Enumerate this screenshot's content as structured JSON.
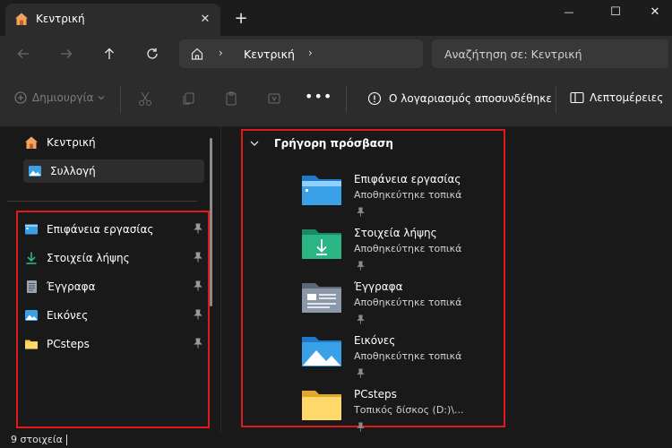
{
  "window": {
    "tab_title": "Κεντρική",
    "tab_close": "✕",
    "new_tab": "+",
    "minimize": "—",
    "maximize": "☐",
    "close": "✕"
  },
  "navbar": {
    "breadcrumb": "Κεντρική",
    "breadcrumb_sep": "›",
    "search_placeholder": "Αναζήτηση σε: Κεντρική"
  },
  "toolbar": {
    "new_label": "Δημιουργία",
    "more": "•••",
    "disconnected_label": "Ο λογαριασμός αποσυνδέθηκε",
    "details_label": "Λεπτομέρειες"
  },
  "sidebar": {
    "top": [
      {
        "label": "Κεντρική",
        "icon": "home-icon"
      },
      {
        "label": "Συλλογή",
        "icon": "gallery-icon"
      }
    ],
    "pinned": [
      {
        "label": "Επιφάνεια εργασίας",
        "icon": "desktop-icon"
      },
      {
        "label": "Στοιχεία λήψης",
        "icon": "download-icon"
      },
      {
        "label": "Έγγραφα",
        "icon": "documents-icon"
      },
      {
        "label": "Εικόνες",
        "icon": "pictures-icon"
      },
      {
        "label": "PCsteps",
        "icon": "folder-icon"
      }
    ]
  },
  "quick_access": {
    "title": "Γρήγορη πρόσβαση",
    "items": [
      {
        "name": "Επιφάνεια εργασίας",
        "sub": "Αποθηκεύτηκε τοπικά",
        "icon": "desktop-folder-icon"
      },
      {
        "name": "Στοιχεία λήψης",
        "sub": "Αποθηκεύτηκε τοπικά",
        "icon": "downloads-folder-icon"
      },
      {
        "name": "Έγγραφα",
        "sub": "Αποθηκεύτηκε τοπικά",
        "icon": "documents-folder-icon"
      },
      {
        "name": "Εικόνες",
        "sub": "Αποθηκεύτηκε τοπικά",
        "icon": "pictures-folder-icon"
      },
      {
        "name": "PCsteps",
        "sub": "Τοπικός δίσκος (D:)\\...",
        "icon": "yellow-folder-icon"
      }
    ]
  },
  "status": {
    "count": "9 στοιχεία"
  },
  "colors": {
    "highlight": "#e01a1a",
    "accent_blue": "#3aa0e8",
    "accent_green": "#2bb585",
    "folder_yellow": "#f5c84c"
  }
}
